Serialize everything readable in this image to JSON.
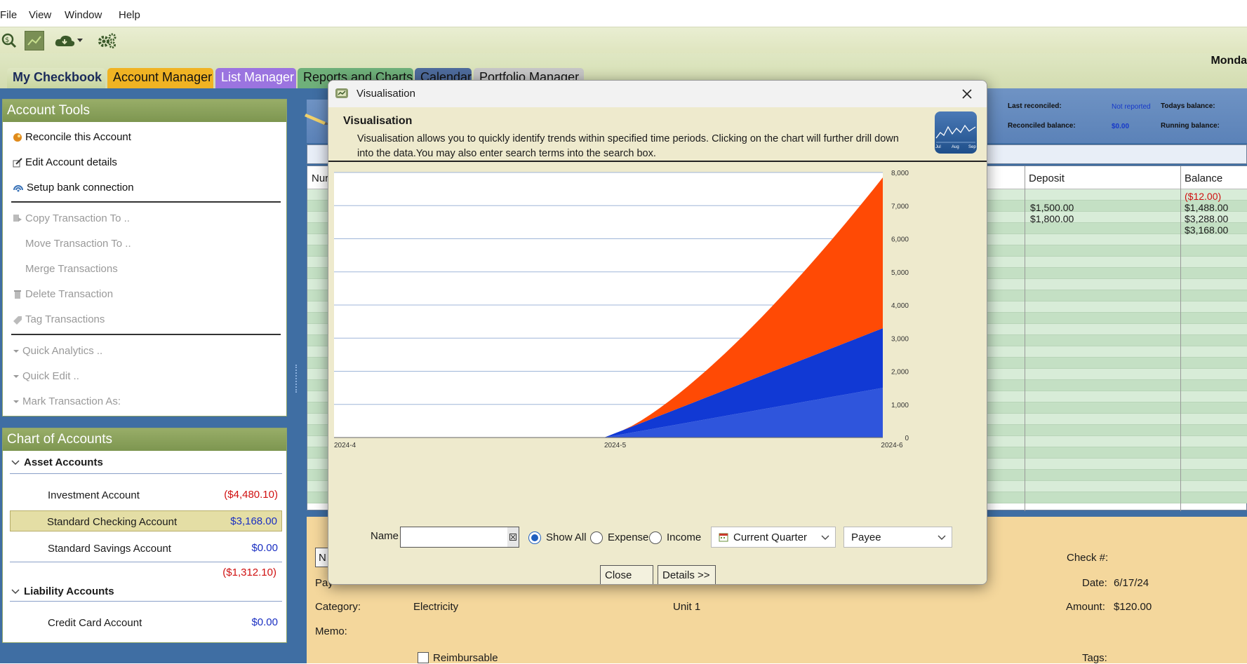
{
  "menu": [
    "File",
    "View",
    "Window",
    "Help"
  ],
  "header": {
    "date_text": "Monda"
  },
  "tabs": [
    {
      "label": "My Checkbook",
      "bg": "#2f63a6",
      "color": "#ffffff"
    },
    {
      "label": "Account Manager",
      "bg": "#f0b323",
      "color": "#111111"
    },
    {
      "label": "List Manager",
      "bg": "#9b74e0",
      "color": "#ffffff"
    },
    {
      "label": "Reports and Charts",
      "bg": "#6fb07a",
      "color": "#111111"
    },
    {
      "label": "Calendar",
      "bg": "#4e6b9c",
      "color": "#111111"
    },
    {
      "label": "Portfolio Manager",
      "bg": "#c7c7c7",
      "color": "#111111"
    }
  ],
  "account_tools": {
    "title": "Account Tools",
    "items": [
      {
        "label": "Reconcile this Account",
        "enabled": true,
        "icon": "reconcile-icon"
      },
      {
        "label": "Edit Account details",
        "enabled": true,
        "icon": "edit-icon"
      },
      {
        "label": "Setup bank connection",
        "enabled": true,
        "icon": "bank-connection-icon"
      },
      {
        "label": "Copy Transaction To ..",
        "enabled": false,
        "icon": "copy-icon"
      },
      {
        "label": "Move Transaction To ..",
        "enabled": false,
        "icon": ""
      },
      {
        "label": "Merge Transactions",
        "enabled": false,
        "icon": ""
      },
      {
        "label": "Delete Transaction",
        "enabled": false,
        "icon": "trash-icon"
      },
      {
        "label": "Tag Transactions",
        "enabled": false,
        "icon": "tag-icon"
      },
      {
        "label": "Quick Analytics ..",
        "enabled": false,
        "icon": "chevron-down-icon"
      },
      {
        "label": "Quick Edit ..",
        "enabled": false,
        "icon": "chevron-down-icon"
      },
      {
        "label": "Mark Transaction As:",
        "enabled": false,
        "icon": "chevron-down-icon"
      }
    ]
  },
  "chart_of_accounts": {
    "title": "Chart of Accounts",
    "asset_header": "Asset Accounts",
    "assets": [
      {
        "name": "Investment Account",
        "value": "($4,480.10)",
        "color": "#d01010"
      },
      {
        "name": "Standard Checking Account",
        "value": "$3,168.00",
        "color": "#1a2fc2"
      },
      {
        "name": "Standard Savings Account",
        "value": "$0.00",
        "color": "#1a2fc2"
      }
    ],
    "asset_total": "($1,312.10)",
    "liability_header": "Liability Accounts",
    "liabilities": [
      {
        "name": "Credit Card Account",
        "value": "$0.00",
        "color": "#1a2fc2"
      }
    ]
  },
  "summary": {
    "last_reconciled_label": "Last reconciled:",
    "last_reconciled_value": "Not reported",
    "todays_balance_label": "Todays balance:",
    "reconciled_balance_label": "Reconciled balance:",
    "reconciled_balance_value": "$0.00",
    "running_balance_label": "Running balance:"
  },
  "register": {
    "left_col_header": "Nur",
    "deposit_header": "Deposit",
    "balance_header": "Balance",
    "rows": [
      {
        "deposit": "",
        "balance": "($12.00)",
        "neg": true
      },
      {
        "deposit": "$1,500.00",
        "balance": "$1,488.00",
        "neg": false
      },
      {
        "deposit": "$1,800.00",
        "balance": "$3,288.00",
        "neg": false
      },
      {
        "deposit": "",
        "balance": "$3,168.00",
        "neg": false
      }
    ]
  },
  "detail": {
    "payee_label": "Pay",
    "category_label": "Category:",
    "category_value": "Electricity",
    "class_value": "Unit 1",
    "memo_label": "Memo:",
    "reimbursable_label": "Reimbursable",
    "check_label": "Check #:",
    "date_label": "Date:",
    "date_value": "6/17/24",
    "amount_label": "Amount:",
    "amount_value": "$120.00",
    "tags_label": "Tags:",
    "num_label": "N"
  },
  "modal": {
    "title": "Visualisation",
    "heading": "Visualisation",
    "description": "Visualisation allows you to quickly identify trends within specified time periods. Clicking on the chart will further drill down into the data.You may also enter search terms into the search box.",
    "thumb_labels": [
      "Jul",
      "Aug",
      "Sep"
    ],
    "name_label": "Name",
    "name_value": "",
    "filters": [
      {
        "label": "Show All",
        "selected": true
      },
      {
        "label": "Expense",
        "selected": false
      },
      {
        "label": "Income",
        "selected": false
      }
    ],
    "period_value": "Current Quarter",
    "group_value": "Payee",
    "close_label": "Close",
    "details_label": "Details >>"
  },
  "chart_data": {
    "type": "area",
    "stacked": true,
    "x": [
      "2024-4",
      "2024-5",
      "2024-6"
    ],
    "ylim": [
      0,
      8000
    ],
    "yticks": [
      "8,000",
      "7,000",
      "6,000",
      "5,000",
      "4,000",
      "3,000",
      "2,000",
      "1,000",
      "0"
    ],
    "series": [
      {
        "color": "#2f55dc",
        "values": [
          0,
          0,
          1500
        ]
      },
      {
        "color": "#1139d4",
        "values": [
          0,
          0,
          1800
        ]
      },
      {
        "color": "#ff4a05",
        "values": [
          0,
          0,
          4550
        ]
      }
    ],
    "grid": true
  }
}
